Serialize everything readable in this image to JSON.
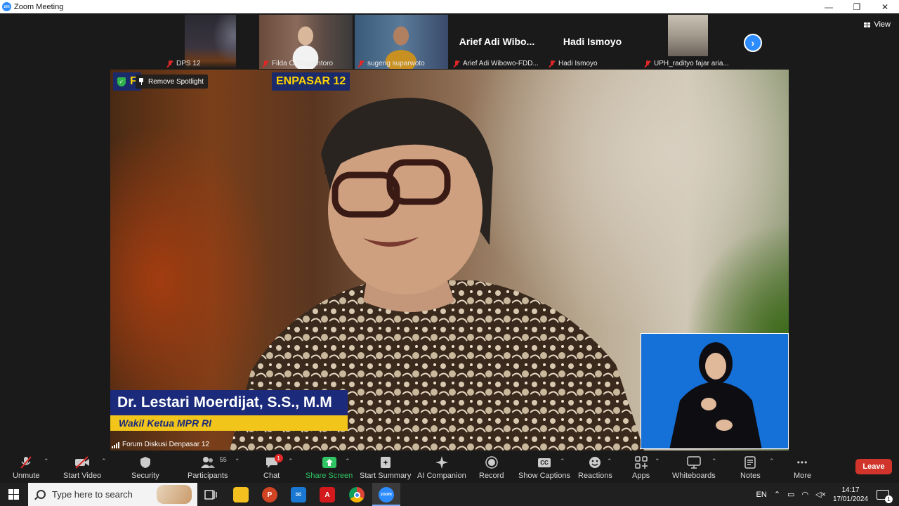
{
  "window": {
    "logo_text": "zm",
    "title": "Zoom Meeting",
    "minimize": "—",
    "restore": "❐",
    "close": "✕"
  },
  "view_button": {
    "label": "View",
    "icon": "grid-view-icon"
  },
  "participants_strip": [
    {
      "name": "DPS 12",
      "display": "",
      "muted": true
    },
    {
      "name": "Filda C Yusgiantoro",
      "display": "",
      "muted": true
    },
    {
      "name": "sugeng suparwoto",
      "display": "",
      "muted": true
    },
    {
      "name": "Arief Adi Wibowo-FDD...",
      "display": "Arief  Adi  Wibo...",
      "muted": true
    },
    {
      "name": "Hadi Ismoyo",
      "display": "Hadi Ismoyo",
      "muted": true
    },
    {
      "name": "UPH_radityo fajar aria...",
      "display": "",
      "muted": true
    }
  ],
  "next_page_icon": "chevron-right-icon",
  "main_video": {
    "spotlight_prefix": "F",
    "channel_badge": "ENPASAR 12",
    "remove_spotlight": "Remove Spotlight",
    "speaker_name": "Dr. Lestari Moerdijat, S.S., M.M",
    "speaker_role": "Wakil Ketua MPR RI",
    "participant_label": "Forum Diskusi Denpasar 12"
  },
  "toolbar": {
    "unmute": "Unmute",
    "start_video": "Start Video",
    "security": "Security",
    "participants": "Participants",
    "participants_count": "55",
    "chat": "Chat",
    "chat_badge": "1",
    "share_screen": "Share Screen",
    "start_summary": "Start Summary",
    "ai_companion": "AI Companion",
    "record": "Record",
    "show_captions": "Show Captions",
    "captions_icon_text": "CC",
    "reactions": "Reactions",
    "apps": "Apps",
    "whiteboards": "Whiteboards",
    "notes": "Notes",
    "more": "More",
    "more_icon_text": "•••",
    "leave": "Leave"
  },
  "taskbar": {
    "search_placeholder": "Type here to search",
    "language": "EN",
    "time": "14:17",
    "date": "17/01/2024",
    "notification_count": "1",
    "apps": [
      "task-view-icon",
      "file-explorer-icon",
      "powerpoint-icon",
      "mail-icon",
      "acrobat-icon",
      "chrome-icon",
      "zoom-icon"
    ]
  },
  "colors": {
    "zoom_blue": "#2d8cff",
    "leave_red": "#d1342a",
    "share_green": "#30c464",
    "lower_third_blue": "#1b2a7a",
    "lower_third_yellow": "#f2c51b"
  }
}
